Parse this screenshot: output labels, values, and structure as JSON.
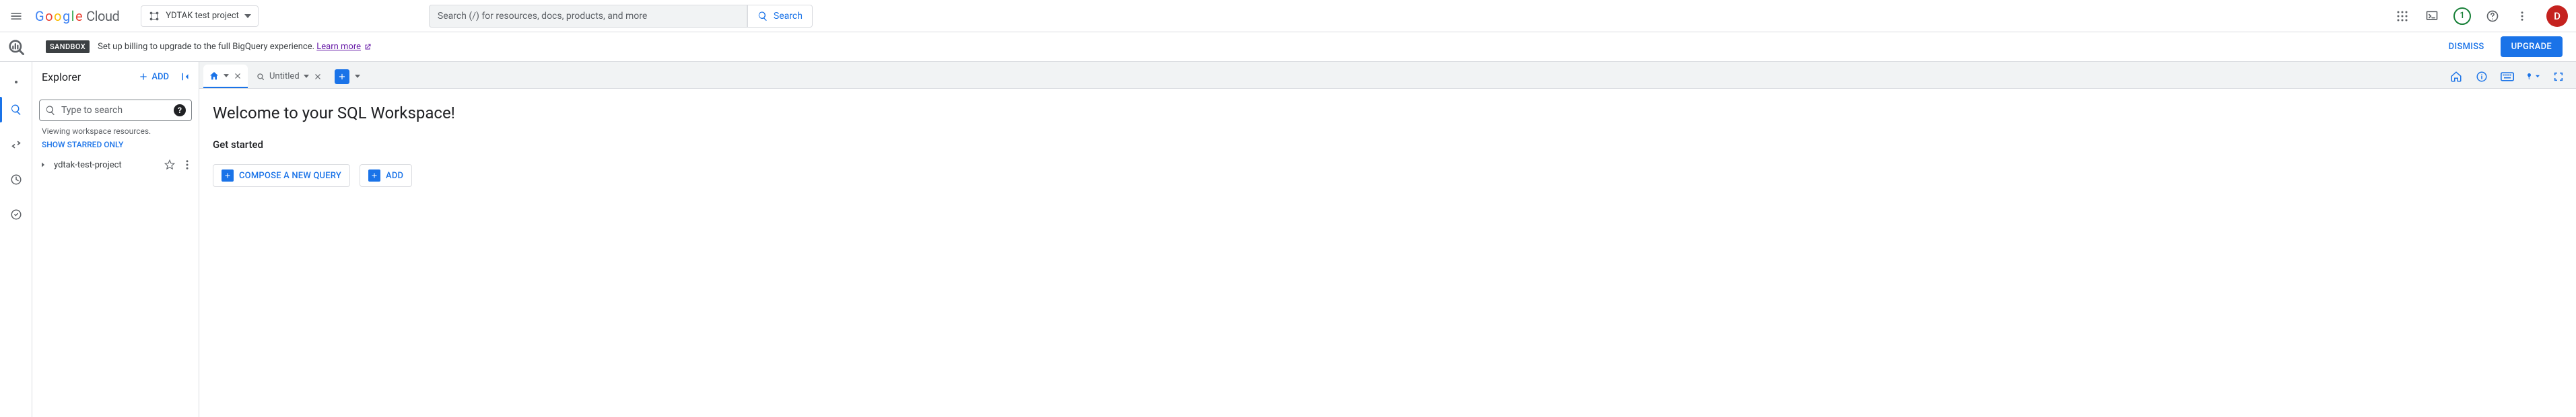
{
  "header": {
    "cloud_label": "Cloud",
    "project_name": "YDTAK test project",
    "search_placeholder": "Search (/) for resources, docs, products, and more",
    "search_btn": "Search",
    "trial_count": "1",
    "avatar_initial": "D"
  },
  "banner": {
    "chip": "SANDBOX",
    "message": "Set up billing to upgrade to the full BigQuery experience.",
    "learn_more": "Learn more",
    "dismiss": "DISMISS",
    "upgrade": "UPGRADE"
  },
  "explorer": {
    "title": "Explorer",
    "add": "ADD",
    "search_placeholder": "Type to search",
    "viewing": "Viewing workspace resources.",
    "starred": "SHOW STARRED ONLY",
    "project": "ydtak-test-project"
  },
  "tabs": {
    "untitled": "Untitled"
  },
  "welcome": {
    "title": "Welcome to your SQL Workspace!",
    "subtitle": "Get started",
    "compose": "COMPOSE A NEW QUERY",
    "add": "ADD"
  }
}
